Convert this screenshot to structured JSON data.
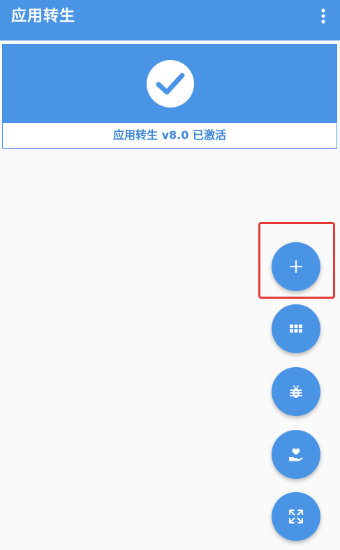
{
  "appbar": {
    "title": "应用转生",
    "menu_icon": "more-vert-icon"
  },
  "status_card": {
    "icon": "check-circle-icon",
    "status_text": "应用转生 v8.0 已激活"
  },
  "fabs": [
    {
      "name": "add",
      "icon": "plus-icon"
    },
    {
      "name": "grid",
      "icon": "apps-grid-icon"
    },
    {
      "name": "debug",
      "icon": "bug-icon"
    },
    {
      "name": "donate",
      "icon": "heart-hand-icon"
    },
    {
      "name": "fullscreen",
      "icon": "expand-icon"
    }
  ],
  "colors": {
    "primary": "#4a94e6",
    "status_text": "#3c86d8",
    "highlight": "#e53935",
    "background": "#fafafa"
  }
}
